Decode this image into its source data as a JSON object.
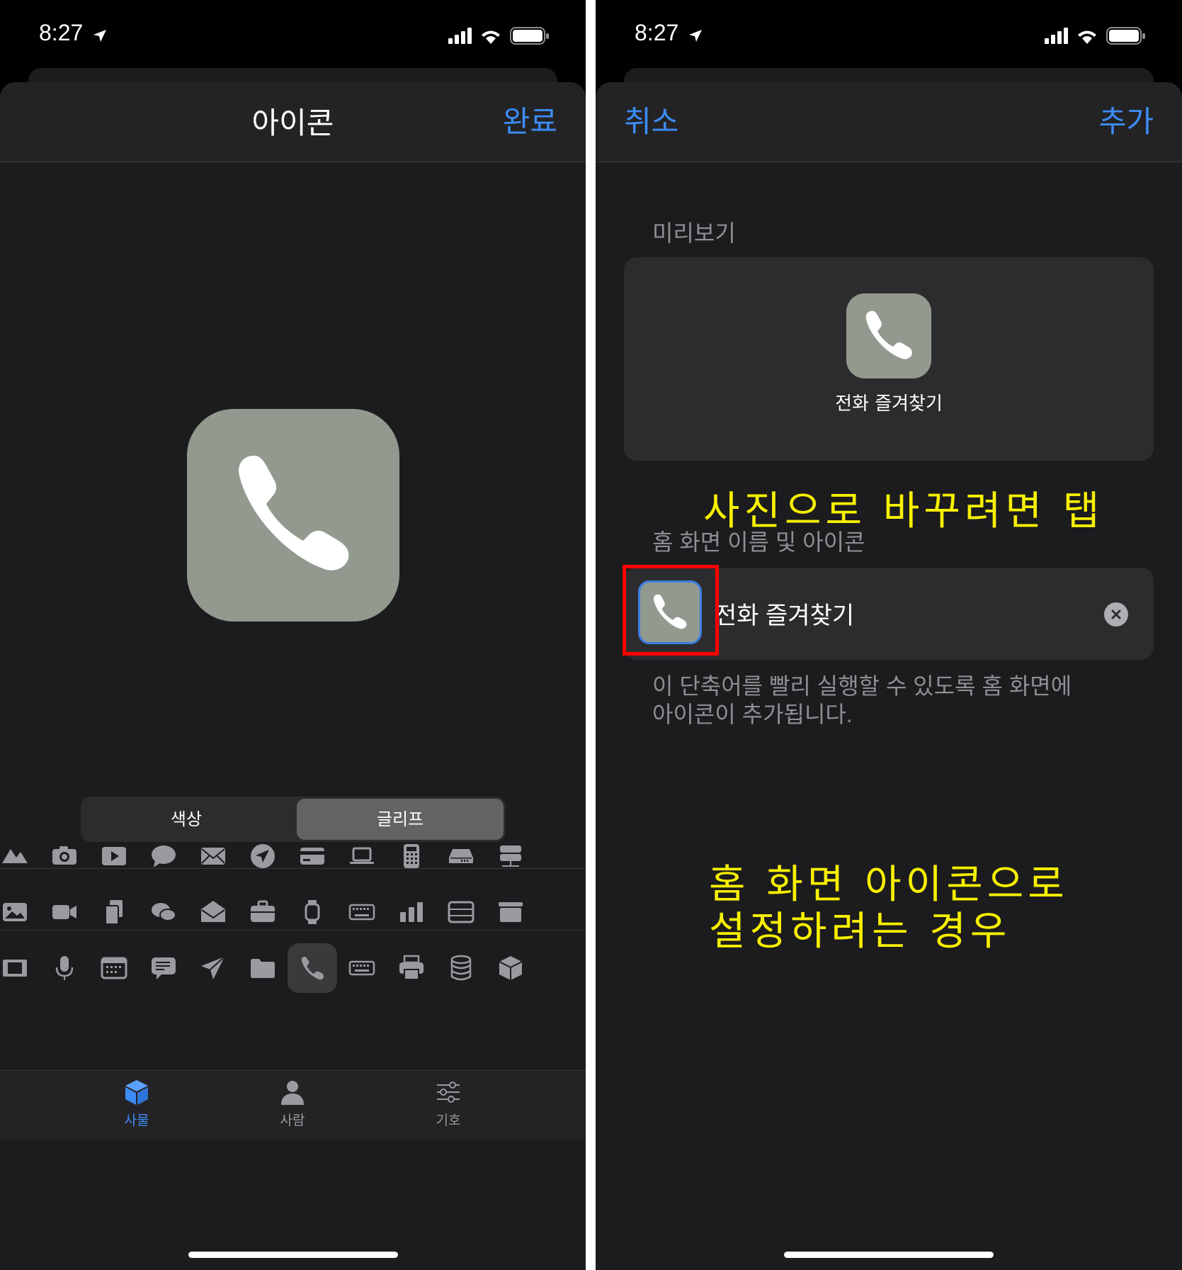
{
  "left": {
    "status": {
      "time": "8:27"
    },
    "nav": {
      "title": "아이콘",
      "done": "완료"
    },
    "segment": {
      "color": "색상",
      "glyph": "글리프",
      "selected": "glyph"
    },
    "tabs": [
      {
        "label": "사물",
        "icon": "cube-icon",
        "active": true
      },
      {
        "label": "사람",
        "icon": "person-icon",
        "active": false
      },
      {
        "label": "기호",
        "icon": "sliders-icon",
        "active": false
      }
    ],
    "glyph_rows": [
      [
        "mountain-icon",
        "camera-icon",
        "play-rectangle-icon",
        "speech-bubble-icon",
        "envelope-icon",
        "location-arrow-icon",
        "credit-card-icon",
        "laptop-icon",
        "calculator-icon",
        "hard-drive-icon",
        "server-rack-icon"
      ],
      [
        "photo-icon",
        "video-camera-icon",
        "documents-icon",
        "chat-bubbles-icon",
        "envelope-open-icon",
        "briefcase-icon",
        "watch-icon",
        "keyboard-icon",
        "bar-chart-icon",
        "archive-box-icon",
        "tray-icon"
      ],
      [
        "film-icon",
        "microphone-icon",
        "calendar-icon",
        "message-text-icon",
        "paper-plane-icon",
        "folder-icon",
        "phone-icon",
        "keyboard-small-icon",
        "printer-icon",
        "database-icon",
        "cube-outline-icon"
      ]
    ],
    "selected_glyph": "phone-icon"
  },
  "right": {
    "status": {
      "time": "8:27"
    },
    "nav": {
      "cancel": "취소",
      "add": "추가"
    },
    "preview_label": "미리보기",
    "preview_name": "전화 즐겨찾기",
    "home_section_label": "홈 화면 이름 및 아이콘",
    "name_field_value": "전화 즐겨찾기",
    "footer_note_line1": "이 단축어를 빨리 실행할 수 있도록 홈 화면에",
    "footer_note_line2": "아이콘이 추가됩니다.",
    "annotation_top": "사진으로 바꾸려면 탭",
    "annotation_bottom_line1": "홈 화면 아이콘으로",
    "annotation_bottom_line2": "설정하려는 경우"
  },
  "colors": {
    "accent": "#3d8cf5",
    "icon_bg": "#929a8f",
    "highlight_box": "#ff0000",
    "annotation": "#f8f000"
  }
}
